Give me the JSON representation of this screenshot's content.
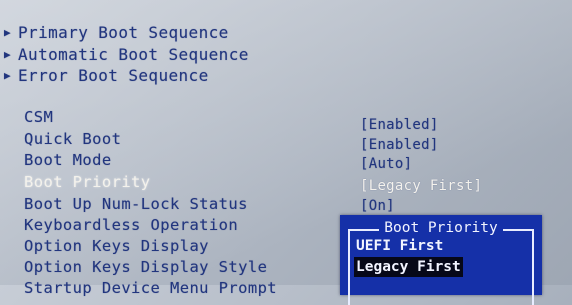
{
  "menu_entries": [
    {
      "label": "Primary Boot Sequence"
    },
    {
      "label": "Automatic Boot Sequence"
    },
    {
      "label": "Error Boot Sequence"
    }
  ],
  "settings": [
    {
      "label": "CSM",
      "value": "[Enabled]"
    },
    {
      "label": "Quick Boot",
      "value": "[Enabled]"
    },
    {
      "label": "Boot Mode",
      "value": "[Auto]"
    },
    {
      "label": "Boot Priority",
      "value": "[Legacy First]",
      "selected": true
    },
    {
      "label": "Boot Up Num-Lock Status",
      "value": "[On]"
    },
    {
      "label": "Keyboardless Operation",
      "value": ""
    },
    {
      "label": "Option Keys Display",
      "value": ""
    },
    {
      "label": "Option Keys Display Style",
      "value": ""
    },
    {
      "label": "Startup Device Menu Prompt",
      "value": ""
    }
  ],
  "popup": {
    "title": "Boot Priority",
    "options": [
      {
        "label": "UEFI First",
        "active": false
      },
      {
        "label": "Legacy First",
        "active": true
      }
    ]
  },
  "colors": {
    "text": "#21357e",
    "highlight_text": "#f4f2ec",
    "popup_background": "#1530a8",
    "popup_selection": "#060818"
  },
  "icons": {
    "submenu_marker": "triangle-right-icon"
  }
}
